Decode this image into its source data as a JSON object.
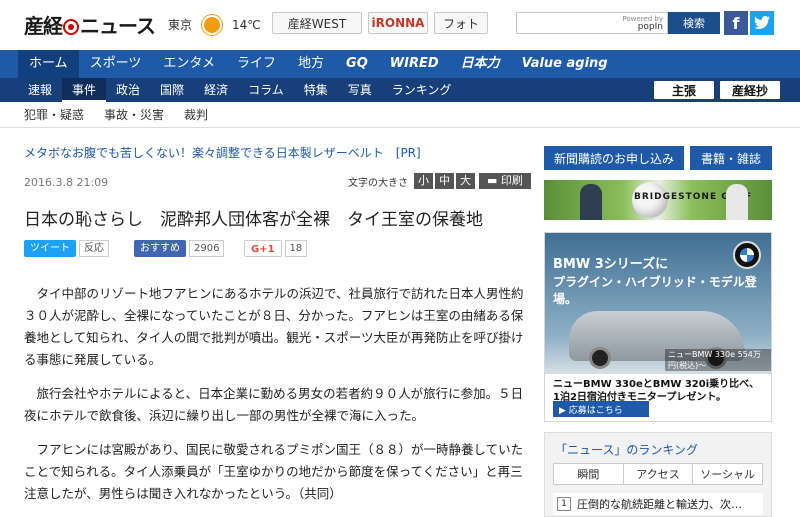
{
  "header": {
    "logo": "産経ニュース",
    "logo_part1": "産経",
    "logo_part2": "ニュース",
    "city": "東京",
    "temp": "14℃",
    "links": [
      "産経WEST",
      "iRONNA",
      "フォト"
    ],
    "search_powered": "Powered by",
    "search_brand": "popIn",
    "search_button": "検索"
  },
  "nav_main": [
    "ホーム",
    "スポーツ",
    "エンタメ",
    "ライフ",
    "地方",
    "GQ",
    "WIRED",
    "日本力",
    "Value aging"
  ],
  "nav_sub": [
    "速報",
    "事件",
    "政治",
    "国際",
    "経済",
    "コラム",
    "特集",
    "写真",
    "ランキング"
  ],
  "nav_sub_right": [
    "主張",
    "産経抄"
  ],
  "nav_third": [
    "犯罪・疑惑",
    "事故・災害",
    "裁判"
  ],
  "article": {
    "pr": "メタボなお腹でも苦しくない！楽々調整できる日本製レザーベルト　[PR]",
    "date": "2016.3.8 21:09",
    "fontsize_label": "文字の大きさ",
    "fontsize": [
      "小",
      "中",
      "大"
    ],
    "print": "印刷",
    "title": "日本の恥さらし　泥酔邦人団体客が全裸　タイ王室の保養地",
    "share": {
      "tweet": "ツイート",
      "tweet_count": "反応",
      "fb": "おすすめ",
      "fb_count": "2906",
      "gplus": "G+1",
      "gplus_count": "18"
    },
    "paragraphs": [
      "タイ中部のリゾート地フアヒンにあるホテルの浜辺で、社員旅行で訪れた日本人男性約３０人が泥酔し、全裸になっていたことが８日、分かった。フアヒンは王室の由緒ある保養地として知られ、タイ人の間で批判が噴出。観光・スポーツ大臣が再発防止を呼び掛ける事態に発展している。",
      "旅行会社やホテルによると、日本企業に勤める男女の若者約９０人が旅行に参加。５日夜にホテルで飲食後、浜辺に繰り出し一部の男性が全裸で海に入った。",
      "フアヒンには宮殿があり、国民に敬愛されるプミポン国王（８８）が一時静養していたことで知られる。タイ人添乗員が「王室ゆかりの地だから節度を保ってください」と再三注意したが、男性らは聞き入れなかったという。（共同）"
    ]
  },
  "sidebar": {
    "subscribe": "新聞購読のお申し込み",
    "books": "書籍・雑誌",
    "golf_ad_text": "BRIDGESTONE GOLF",
    "bmw_ad": {
      "head1": "BMW 3シリーズに",
      "head2": "プラグイン・ハイブリッド・モデル登場。",
      "spec": "ニューBMW 330e 554万円(税込)～",
      "sub1": "ニューBMW 330eとBMW 320i乗り比べ、",
      "sub2": "1泊2日宿泊付きモニタープレゼント。",
      "cta": "▶ 応募はこちら"
    },
    "ranking": {
      "title": "「ニュース」のランキング",
      "tabs": [
        "瞬間",
        "アクセス",
        "ソーシャル"
      ],
      "first_num": "1",
      "first_item": "圧倒的な航続距離と輸送力、次…"
    }
  }
}
